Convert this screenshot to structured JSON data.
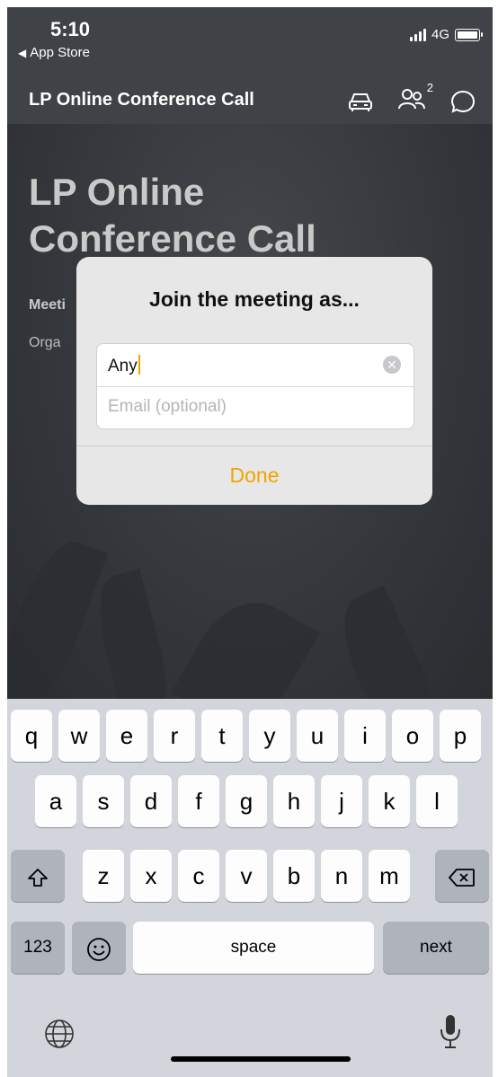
{
  "status": {
    "time": "5:10",
    "back_app": "App Store",
    "network": "4G"
  },
  "nav": {
    "title": "LP Online Conference Call",
    "participants_badge": "2"
  },
  "background": {
    "title_line1": "LP Online",
    "title_line2": "Conference Call",
    "meeting_label": "Meeti",
    "organizer_label": "Orga"
  },
  "dialog": {
    "title": "Join the meeting as...",
    "name_value": "Any",
    "email_placeholder": "Email (optional)",
    "done_label": "Done",
    "accent_color": "#f0a400"
  },
  "keyboard": {
    "row1": [
      "q",
      "w",
      "e",
      "r",
      "t",
      "y",
      "u",
      "i",
      "o",
      "p"
    ],
    "row2": [
      "a",
      "s",
      "d",
      "f",
      "g",
      "h",
      "j",
      "k",
      "l"
    ],
    "row3": [
      "z",
      "x",
      "c",
      "v",
      "b",
      "n",
      "m"
    ],
    "numbers_label": "123",
    "space_label": "space",
    "next_label": "next"
  }
}
